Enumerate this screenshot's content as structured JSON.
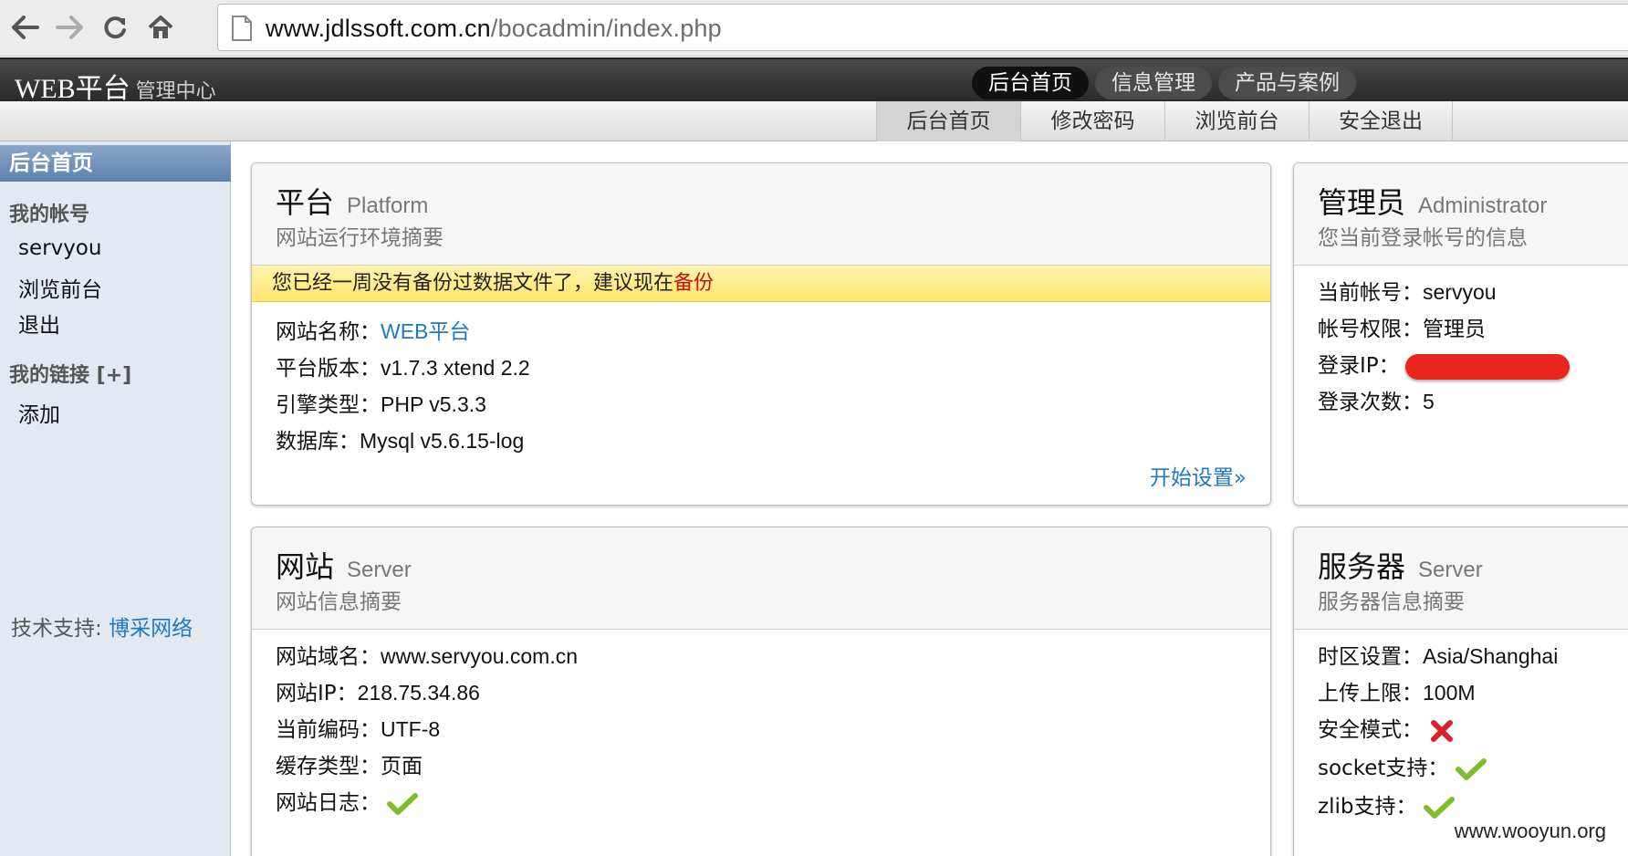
{
  "browser": {
    "url_host": "www.jdlssoft.com.cn",
    "url_path": "/bocadmin/index.php"
  },
  "app": {
    "logo": "WEB平台",
    "subtitle": "管理中心",
    "main_tabs": [
      {
        "label": "后台首页",
        "active": true
      },
      {
        "label": "信息管理",
        "active": false
      },
      {
        "label": "产品与案例",
        "active": false
      }
    ],
    "sub_tabs": [
      {
        "label": "后台首页",
        "active": true
      },
      {
        "label": "修改密码",
        "active": false
      },
      {
        "label": "浏览前台",
        "active": false
      },
      {
        "label": "安全退出",
        "active": false
      }
    ]
  },
  "sidebar": {
    "title": "后台首页",
    "account_group": "我的帐号",
    "account_items": [
      "servyou",
      "浏览前台",
      "退出"
    ],
    "links_group": "我的链接 [+]",
    "links_items": [
      "添加"
    ],
    "support_label": "技术支持:",
    "support_link": "博采网络"
  },
  "platform_panel": {
    "title": "平台",
    "title_en": "Platform",
    "desc": "网站运行环境摘要",
    "warning_text": "您已经一周没有备份过数据文件了，建议现在",
    "warning_link": "备份",
    "rows": [
      {
        "label": "网站名称：",
        "value": "WEB平台"
      },
      {
        "label": "平台版本：",
        "value": "v1.7.3 xtend 2.2"
      },
      {
        "label": "引擎类型：",
        "value": "PHP v5.3.3"
      },
      {
        "label": "数据库：",
        "value": "Mysql v5.6.15-log"
      }
    ],
    "more": "开始设置»"
  },
  "admin_panel": {
    "title": "管理员",
    "title_en": "Administrator",
    "desc": "您当前登录帐号的信息",
    "rows": [
      {
        "label": "当前帐号：",
        "value": "servyou"
      },
      {
        "label": "帐号权限：",
        "value": "管理员"
      },
      {
        "label": "登录IP：",
        "value": ""
      },
      {
        "label": "登录次数：",
        "value": "5"
      }
    ]
  },
  "site_panel": {
    "title": "网站",
    "title_en": "Server",
    "desc": "网站信息摘要",
    "rows": [
      {
        "label": "网站域名：",
        "value": "www.servyou.com.cn"
      },
      {
        "label": "网站IP：",
        "value": "218.75.34.86"
      },
      {
        "label": "当前编码：",
        "value": "UTF-8"
      },
      {
        "label": "缓存类型：",
        "value": "页面"
      },
      {
        "label": "网站日志：",
        "value": "",
        "icon": "check-icon"
      }
    ]
  },
  "server_panel": {
    "title": "服务器",
    "title_en": "Server",
    "desc": "服务器信息摘要",
    "rows": [
      {
        "label": "时区设置：",
        "value": "Asia/Shanghai"
      },
      {
        "label": "上传上限：",
        "value": "100M"
      },
      {
        "label": "安全模式：",
        "value": "",
        "icon": "cross-icon"
      },
      {
        "label": "socket支持：",
        "value": "",
        "icon": "check-icon"
      },
      {
        "label": "zlib支持：",
        "value": "",
        "icon": "check-icon"
      }
    ]
  },
  "watermark": "www.wooyun.org",
  "colors": {
    "link": "#1f78c4",
    "warning_bg": "#ffe56a",
    "warning_link": "#c21212",
    "check": "#7cbf2a",
    "cross": "#d9232a",
    "redaction": "#e8261c"
  }
}
